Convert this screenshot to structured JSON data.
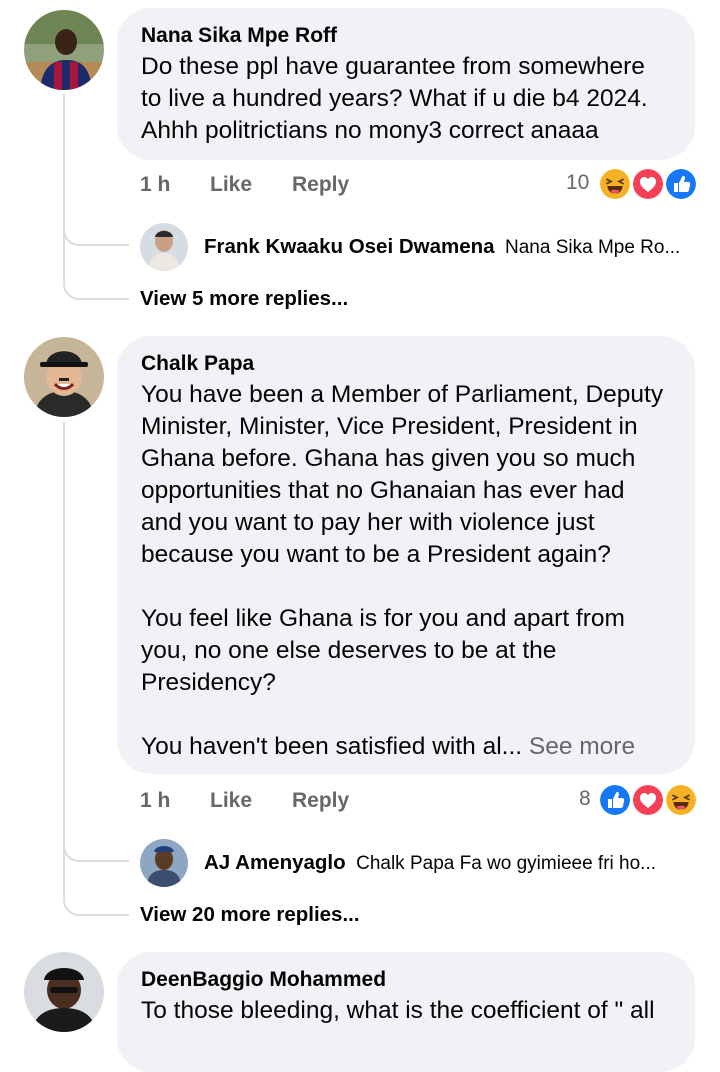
{
  "comments": [
    {
      "author": "Nana Sika Mpe Roff",
      "lines": [
        "Do these ppl have guarantee from somewhere",
        "to live a hundred years? What if u die b4 2024.",
        "Ahhh politrictians no mony3 correct anaaa"
      ],
      "time": "1 h",
      "like_label": "Like",
      "reply_label": "Reply",
      "reaction_count": "10",
      "reactions": [
        "haha",
        "love",
        "like"
      ],
      "reply_preview": {
        "author": "Frank Kwaaku Osei Dwamena",
        "text": "Nana Sika Mpe Ro..."
      },
      "more_replies": "View 5 more replies..."
    },
    {
      "author": "Chalk Papa",
      "lines": [
        "You have been a Member of Parliament, Deputy",
        "Minister, Minister, Vice President, President in",
        "Ghana before. Ghana has given you so much",
        "opportunities that no Ghanaian has ever had",
        "and you want to pay her with violence just",
        "because you want to be a President again?",
        "",
        "You feel like Ghana is for you and apart from",
        "you, no one else deserves to be at the",
        "Presidency?",
        "",
        "You haven't been satisfied with al..."
      ],
      "see_more": "See more",
      "time": "1 h",
      "like_label": "Like",
      "reply_label": "Reply",
      "reaction_count": "8",
      "reactions": [
        "like",
        "love",
        "haha"
      ],
      "reply_preview": {
        "author": "AJ Amenyaglo",
        "text": "Chalk Papa Fa wo gyimieee fri ho..."
      },
      "more_replies": "View 20 more replies..."
    },
    {
      "author": "DeenBaggio Mohammed",
      "lines": [
        "To those bleeding, what is the coefficient of \" all"
      ]
    }
  ],
  "colors": {
    "bubble": "#f0f2f5",
    "meta_text": "#65676b",
    "like_blue": "#1877f2",
    "love_red": "#f33e58",
    "haha_yellow": "#f7b125",
    "thread_line": "#dadde1"
  },
  "icons": {
    "like": "thumbs-up-icon",
    "love": "heart-icon",
    "haha": "laughing-face-icon"
  }
}
